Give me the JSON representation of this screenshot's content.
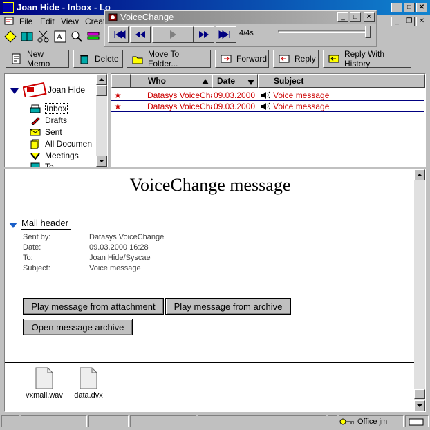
{
  "window": {
    "title": "Joan Hide - Inbox - Lotus Notes",
    "title_visible": "Joan Hide - Inbox - Lo"
  },
  "menu": [
    "File",
    "Edit",
    "View",
    "Creat"
  ],
  "voicechange": {
    "title": "VoiceChange",
    "counter": "4/4s"
  },
  "actions": [
    "New Memo",
    "Delete",
    "Move To Folder...",
    "Forward",
    "Reply",
    "Reply With History"
  ],
  "nav": {
    "user": "Joan Hide",
    "items": [
      "Inbox",
      "Drafts",
      "Sent",
      "All Documen",
      "Meetings",
      "To..."
    ]
  },
  "list": {
    "columns": [
      "Who",
      "Date",
      "Subject"
    ],
    "rows": [
      {
        "who": "Datasys VoiceChar",
        "date": "09.03.2000",
        "subject": "Voice message"
      },
      {
        "who": "Datasys VoiceChar",
        "date": "09.03.2000",
        "subject": "Voice message"
      }
    ]
  },
  "preview": {
    "title": "VoiceChange message",
    "section": "Mail header",
    "fields": [
      {
        "label": "Sent by:",
        "value": "Datasys VoiceChange"
      },
      {
        "label": "Date:",
        "value": "09.03.2000 16:28"
      },
      {
        "label": "To:",
        "value": "Joan Hide/Syscae"
      },
      {
        "label": "Subject:",
        "value": "Voice message"
      }
    ],
    "buttons": [
      "Play message from attachment",
      "Play message from archive",
      "Open message archive"
    ],
    "attachments": [
      "vxmail.wav",
      "data.dvx"
    ]
  },
  "status": {
    "location": "Office jm"
  }
}
